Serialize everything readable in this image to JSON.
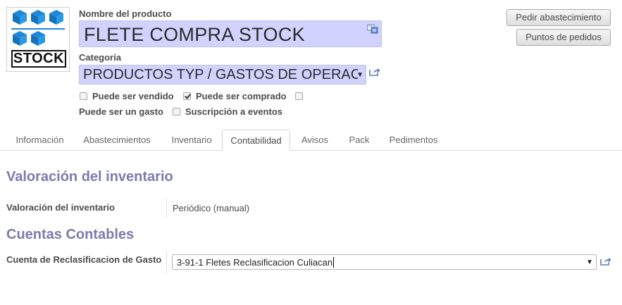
{
  "product": {
    "image_logo_text": "STOCK",
    "name_label": "Nombre del producto",
    "name_value": "FLETE COMPRA STOCK",
    "category_label": "Categoría",
    "category_value": "PRODUCTOS TYP / GASTOS DE OPERACIÓN"
  },
  "checkboxes": [
    {
      "label": "Puede ser vendido",
      "checked": false
    },
    {
      "label": "Puede ser comprado",
      "checked": true
    },
    {
      "label": "",
      "checked": false
    },
    {
      "label": "Puede ser un gasto",
      "checked": null
    },
    {
      "label": "Suscripción a eventos",
      "checked": false
    }
  ],
  "buttons": {
    "procure": "Pedir abastecimiento",
    "reorder_points": "Puntos de pedidos"
  },
  "tabs": [
    {
      "label": "Información",
      "active": false
    },
    {
      "label": "Abastecimientos",
      "active": false
    },
    {
      "label": "Inventario",
      "active": false
    },
    {
      "label": "Contabilidad",
      "active": true
    },
    {
      "label": "Avisos",
      "active": false
    },
    {
      "label": "Pack",
      "active": false
    },
    {
      "label": "Pedimentos",
      "active": false
    }
  ],
  "accounting": {
    "valuation_section_title": "Valoración del inventario",
    "valuation_label": "Valoración del inventario",
    "valuation_value": "Periódico (manual)",
    "accounts_section_title": "Cuentas Contables",
    "reclass_label": "Cuenta de Reclasificacion de Gasto",
    "reclass_value": "3-91-1 Fletes Reclasificacion Culiacan"
  },
  "colors": {
    "required_field_bg": "#d2d2ff",
    "section_title": "#7c7bad",
    "logo_blue": "#1e88d8"
  },
  "icons": {
    "translate": "translate-icon",
    "external_link": "external-link-icon",
    "dropdown": "chevron-down-icon"
  }
}
